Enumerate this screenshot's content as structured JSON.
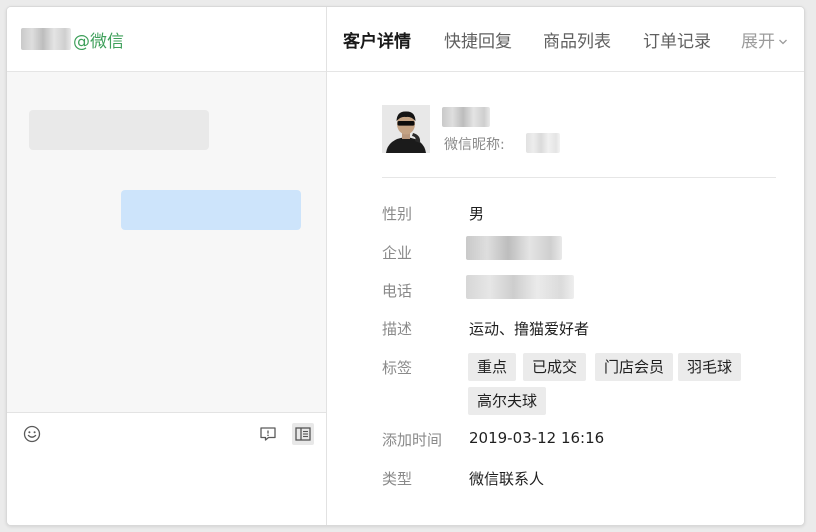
{
  "contact": {
    "suffix": "@微信"
  },
  "tabs": [
    {
      "label": "客户详情",
      "active": true
    },
    {
      "label": "快捷回复",
      "active": false
    },
    {
      "label": "商品列表",
      "active": false
    },
    {
      "label": "订单记录",
      "active": false
    },
    {
      "label": "展开",
      "active": false
    }
  ],
  "profile": {
    "nickname_label": "微信昵称:"
  },
  "fields": {
    "gender": {
      "label": "性别",
      "value": "男"
    },
    "company": {
      "label": "企业"
    },
    "phone": {
      "label": "电话"
    },
    "description": {
      "label": "描述",
      "value": "运动、撸猫爱好者"
    },
    "tags": {
      "label": "标签",
      "items": [
        "重点",
        "已成交",
        "门店会员",
        "羽毛球",
        "高尔夫球"
      ]
    },
    "added_time": {
      "label": "添加时间",
      "value": "2019-03-12 16:16"
    },
    "type": {
      "label": "类型",
      "value": "微信联系人"
    }
  },
  "icons": {
    "emoji": "smiley-icon",
    "quote": "chat-bubble-icon",
    "panel": "sidebar-panel-icon",
    "expand": "chevron-down-icon"
  },
  "colors": {
    "wechat_green": "#3fa05b",
    "sent_bubble": "#cde4fb",
    "received_bubble": "#e9e9e9",
    "tag_bg": "#ebebeb"
  }
}
